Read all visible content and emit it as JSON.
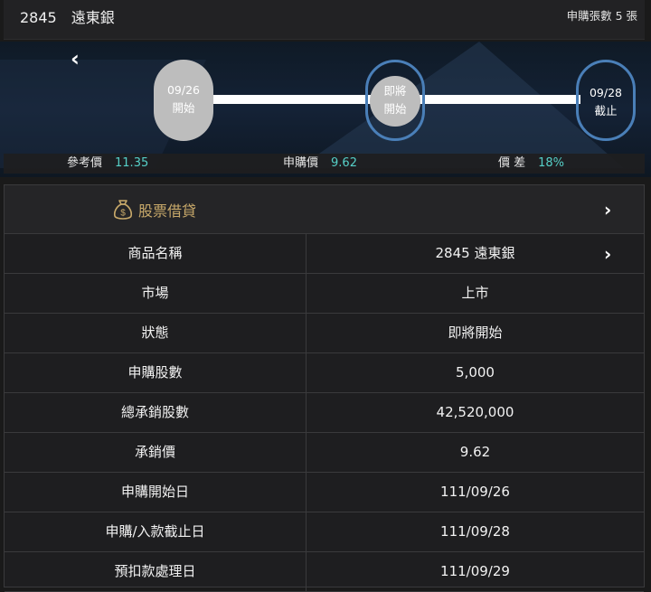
{
  "header": {
    "title": "2845　遠東銀",
    "subscription_count": "申購張數 5 張"
  },
  "timeline": {
    "start": {
      "date": "09/26",
      "label": "開始"
    },
    "current": {
      "line1": "即將",
      "line2": "開始"
    },
    "end": {
      "date": "09/28",
      "label": "截止"
    }
  },
  "prices": {
    "reference_label": "參考價",
    "reference_value": "11.35",
    "subscription_label": "申購價",
    "subscription_value": "9.62",
    "spread_label": "價 差",
    "spread_value": "18%"
  },
  "loan": {
    "label": "股票借貸"
  },
  "rows": [
    {
      "key": "商品名稱",
      "value": "2845 遠東銀",
      "has_chevron": true
    },
    {
      "key": "市場",
      "value": "上市"
    },
    {
      "key": "狀態",
      "value": "即將開始"
    },
    {
      "key": "申購股數",
      "value": "5,000"
    },
    {
      "key": "總承銷股數",
      "value": "42,520,000"
    },
    {
      "key": "承銷價",
      "value": "9.62"
    },
    {
      "key": "申購開始日",
      "value": "111/09/26"
    },
    {
      "key": "申購/入款截止日",
      "value": "111/09/28"
    },
    {
      "key": "預扣款處理日",
      "value": "111/09/29"
    }
  ],
  "colors": {
    "accent_teal": "#56d0c8",
    "ring_blue": "#4a7fb8",
    "gold": "#c8a96a"
  },
  "icons": [
    "chevron-left-icon",
    "money-bag-icon",
    "chevron-right-icon"
  ]
}
